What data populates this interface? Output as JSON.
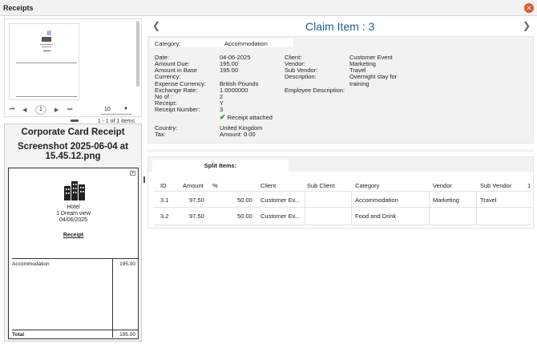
{
  "window": {
    "title": "Receipts",
    "close_glyph": "×"
  },
  "pager": {
    "first": "⏮",
    "prev": "◀",
    "current": "1",
    "next": "▶",
    "last": "⏭",
    "page_size": "10",
    "info": "1 - 1 of 1 items"
  },
  "receipt": {
    "heading": "Corporate Card Receipt",
    "filename_line1": "Screenshot 2025-06-04 at",
    "filename_line2": "15.45.12.png",
    "doc": {
      "merchant": "Hotel",
      "address": "1 Dream view",
      "date": "04/06/2025",
      "title": "Receipt",
      "item": "Accommodation",
      "item_amount": "195.00",
      "total_label": "Total",
      "total_amount": "195.00"
    }
  },
  "claim": {
    "title": "Claim Item : 3",
    "category_label": "Category:",
    "category_value": "Accommodation",
    "fields_left": [
      {
        "label": "Date:",
        "value": "04-06-2025"
      },
      {
        "label": "Amount Due:",
        "value": "195.00"
      },
      {
        "label": "Amount in Base",
        "value": "195.00"
      },
      {
        "label": "Currency:",
        "value": ""
      },
      {
        "label": "Expense Currency:",
        "value": "British Pounds"
      },
      {
        "label": "Exchange Rate:",
        "value": "1.0000000"
      },
      {
        "label": "No of :",
        "value": "2"
      },
      {
        "label": "Receipt:",
        "value": "Y"
      },
      {
        "label": "Receipt Number:",
        "value": "3"
      }
    ],
    "receipt_attached": "Receipt attached",
    "country_label": "Country:",
    "country_value": "United Kingdom",
    "tax_label": "Tax:",
    "tax_value": "Amount: 0.00",
    "fields_right": [
      {
        "label": "Client:",
        "value": "Customer Event"
      },
      {
        "label": "Vendor:",
        "value": "Marketing"
      },
      {
        "label": "Sub Vendor:",
        "value": "Travel"
      },
      {
        "label": "Description:",
        "value": "Overnight stay for training"
      },
      {
        "label": "Employee Description:",
        "value": ""
      }
    ]
  },
  "split_items": {
    "tab_label": "Split Items:",
    "columns": [
      "ID",
      "Amount",
      "%",
      "Client",
      "Sub Client",
      "Category",
      "Vendor",
      "Sub Vendor",
      "1"
    ],
    "rows": [
      [
        "3.1",
        "97.50",
        "50.00",
        "Customer Ev...",
        "",
        "Accommodation",
        "Marketing",
        "Travel"
      ],
      [
        "3.2",
        "97.50",
        "50.00",
        "Customer Ev...",
        "",
        "Food and Drink",
        "",
        ""
      ]
    ]
  },
  "colors": {
    "accent_title": "#1b5e9a",
    "close": "#e0562e",
    "check": "#2e8b2e"
  }
}
